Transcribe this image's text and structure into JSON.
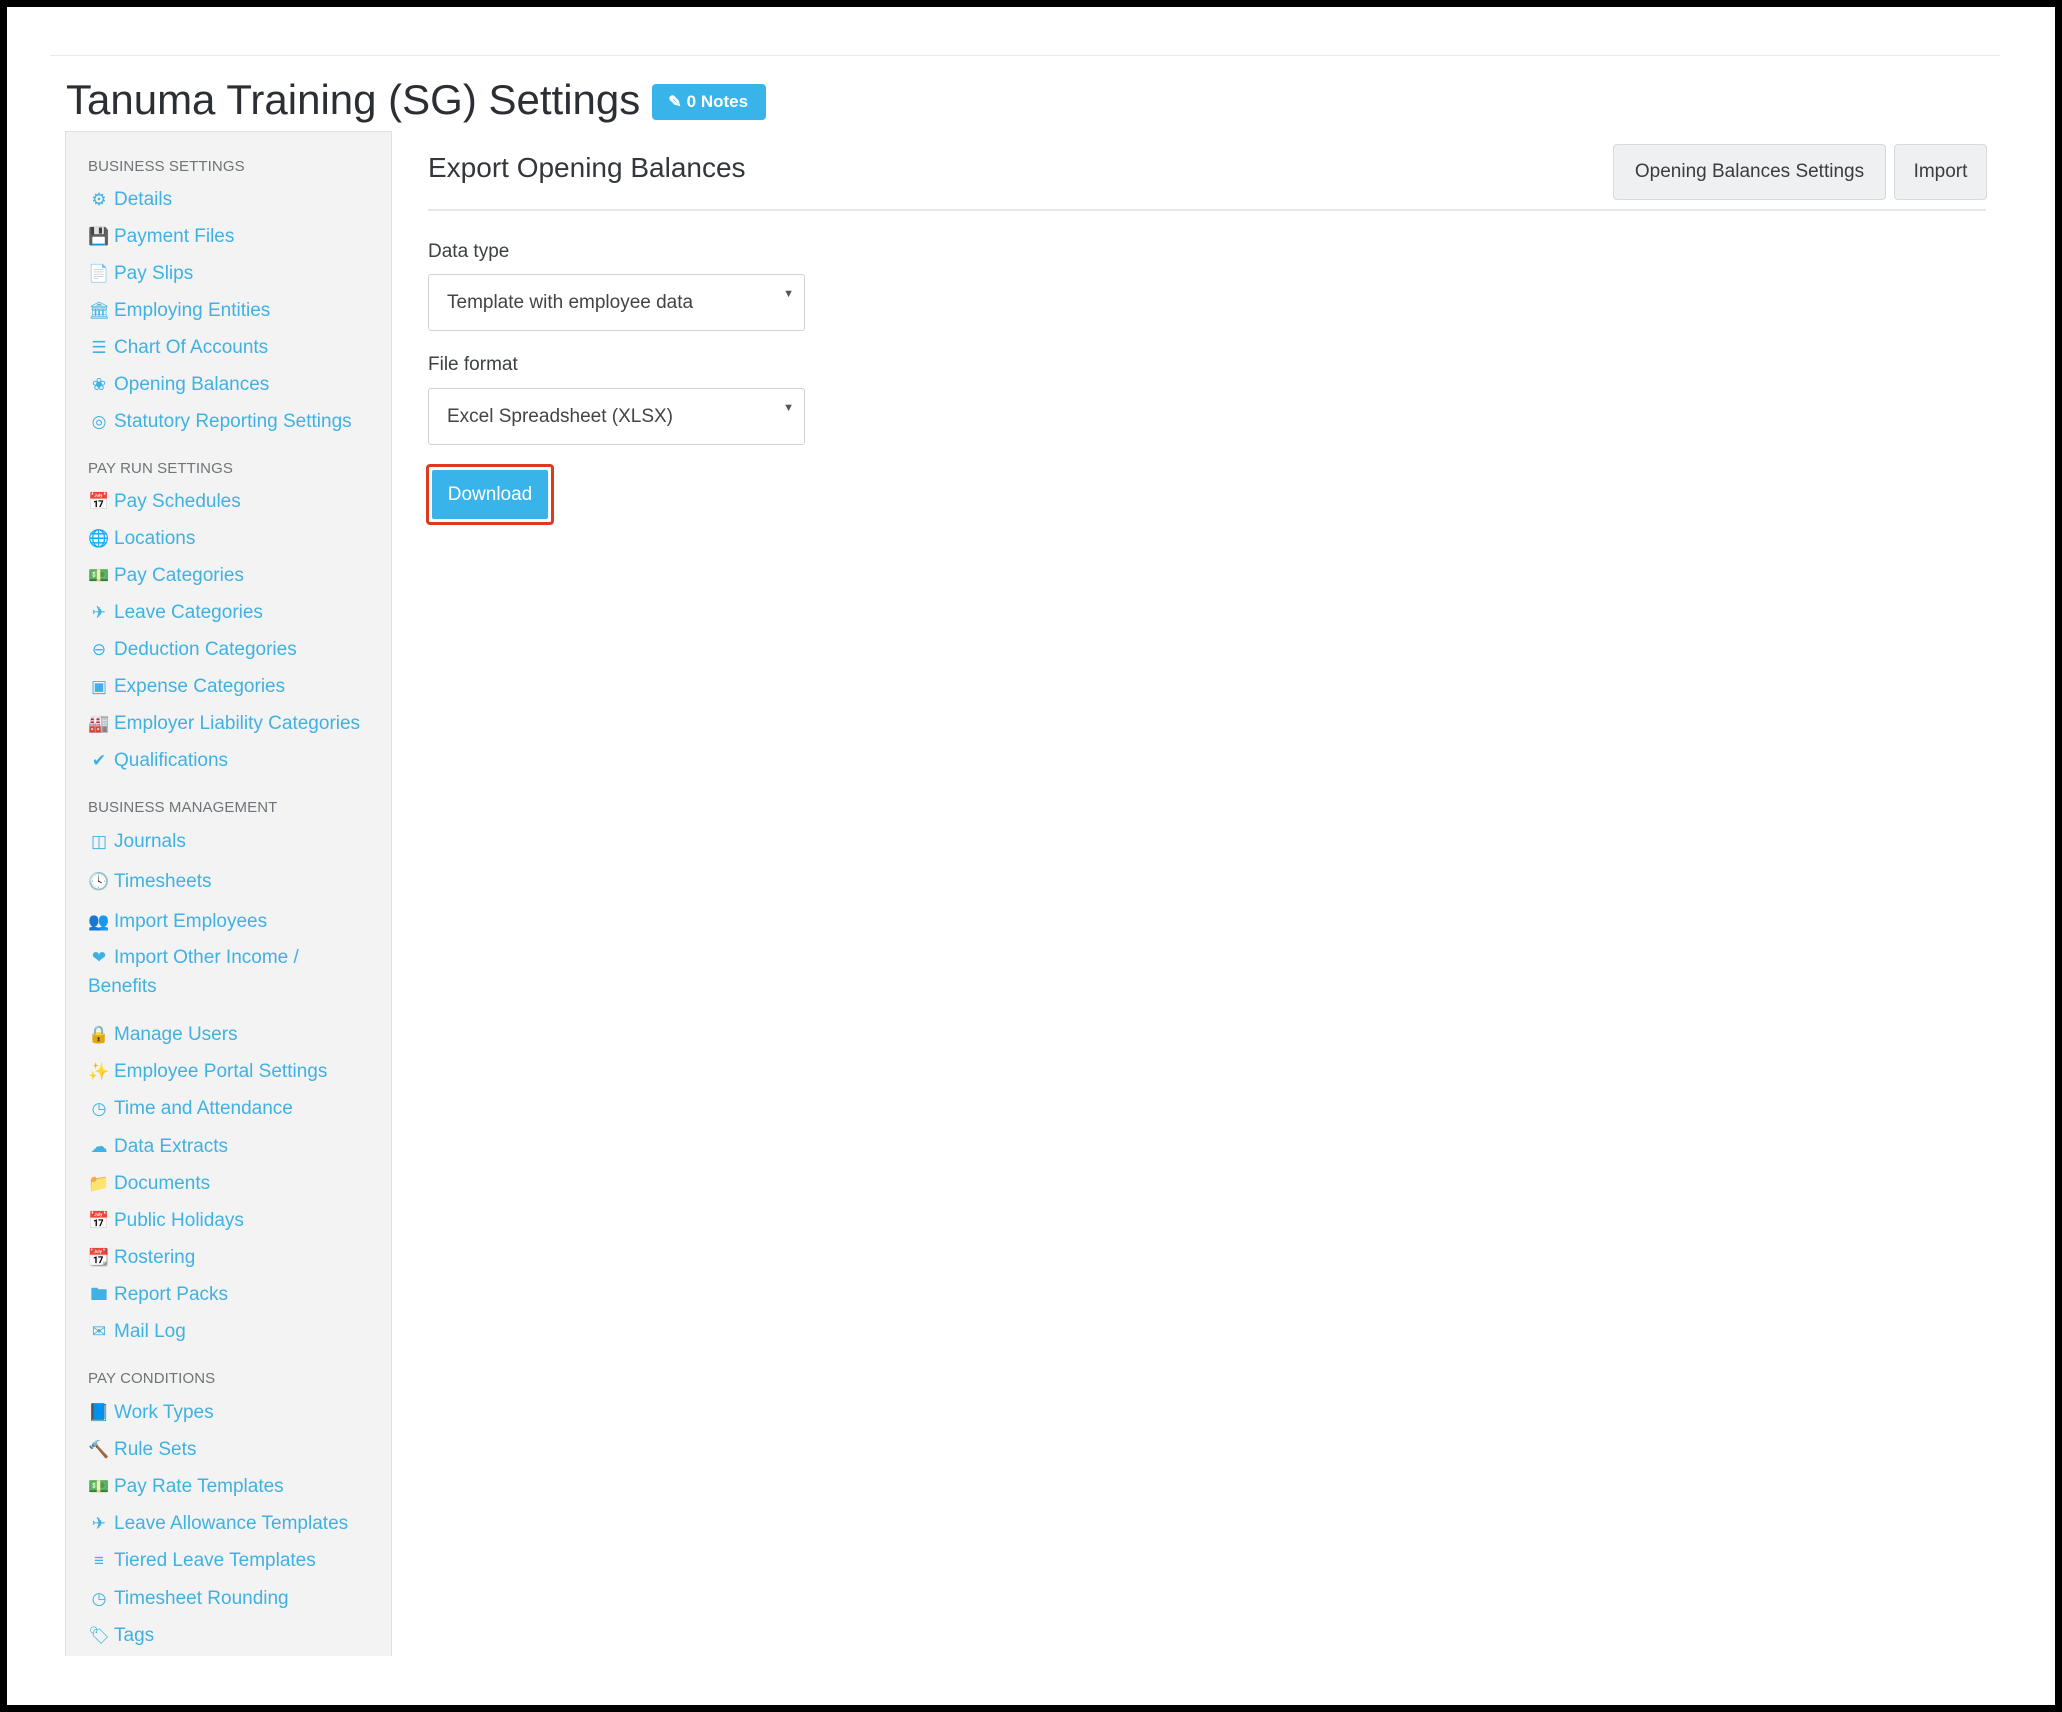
{
  "header": {
    "title": "Tanuma Training (SG) Settings",
    "notes_badge": "0 Notes"
  },
  "sidebar": {
    "groups": [
      {
        "label": "BUSINESS SETTINGS",
        "items": [
          {
            "label": "Details",
            "icon": "gear-icon"
          },
          {
            "label": "Payment Files",
            "icon": "save-icon"
          },
          {
            "label": "Pay Slips",
            "icon": "file-icon"
          },
          {
            "label": "Employing Entities",
            "icon": "bank-icon"
          },
          {
            "label": "Chart Of Accounts",
            "icon": "list-icon"
          },
          {
            "label": "Opening Balances",
            "icon": "leaf-icon"
          },
          {
            "label": "Statutory Reporting Settings",
            "icon": "lifebuoy-icon"
          }
        ]
      },
      {
        "label": "PAY RUN SETTINGS",
        "items": [
          {
            "label": "Pay Schedules",
            "icon": "calendar-icon"
          },
          {
            "label": "Locations",
            "icon": "globe-icon"
          },
          {
            "label": "Pay Categories",
            "icon": "money-icon"
          },
          {
            "label": "Leave Categories",
            "icon": "plane-icon"
          },
          {
            "label": "Deduction Categories",
            "icon": "minus-circle-icon"
          },
          {
            "label": "Expense Categories",
            "icon": "archive-icon"
          },
          {
            "label": "Employer Liability Categories",
            "icon": "industry-icon"
          },
          {
            "label": "Qualifications",
            "icon": "check-icon"
          }
        ]
      },
      {
        "label": "BUSINESS MANAGEMENT",
        "items": [
          {
            "label": "Journals",
            "icon": "columns-icon"
          },
          {
            "label": "Timesheets",
            "icon": "clock-icon"
          },
          {
            "label": "Import Employees",
            "icon": "people-icon"
          },
          {
            "label": "Import Other Income / Benefits",
            "icon": "hand-heart-icon"
          },
          {
            "label": "Manage Users",
            "icon": "lock-icon"
          },
          {
            "label": "Employee Portal Settings",
            "icon": "magic-wand-icon"
          },
          {
            "label": "Time and Attendance",
            "icon": "user-clock-icon"
          },
          {
            "label": "Data Extracts",
            "icon": "cloud-download-icon"
          },
          {
            "label": "Documents",
            "icon": "folder-icon"
          },
          {
            "label": "Public Holidays",
            "icon": "calendar-icon"
          },
          {
            "label": "Rostering",
            "icon": "calendar-grid-icon"
          },
          {
            "label": "Report Packs",
            "icon": "folder-outline-icon"
          },
          {
            "label": "Mail Log",
            "icon": "envelope-icon"
          }
        ]
      },
      {
        "label": "PAY CONDITIONS",
        "items": [
          {
            "label": "Work Types",
            "icon": "book-icon"
          },
          {
            "label": "Rule Sets",
            "icon": "gavel-icon"
          },
          {
            "label": "Pay Rate Templates",
            "icon": "money-icon"
          },
          {
            "label": "Leave Allowance Templates",
            "icon": "plane-icon"
          },
          {
            "label": "Tiered Leave Templates",
            "icon": "align-center-icon"
          },
          {
            "label": "Timesheet Rounding",
            "icon": "clock-outline-icon"
          },
          {
            "label": "Tags",
            "icon": "tag-icon"
          }
        ]
      }
    ]
  },
  "main": {
    "title": "Export Opening Balances",
    "actions": {
      "settings_label": "Opening Balances Settings",
      "import_label": "Import"
    },
    "data_type": {
      "label": "Data type",
      "value": "Template with employee data"
    },
    "file_format": {
      "label": "File format",
      "value": "Excel Spreadsheet (XLSX)"
    },
    "download_label": "Download"
  },
  "colors": {
    "accent": "#39b4ea",
    "link": "#3fb1e2",
    "highlight": "#dd3b1e"
  }
}
